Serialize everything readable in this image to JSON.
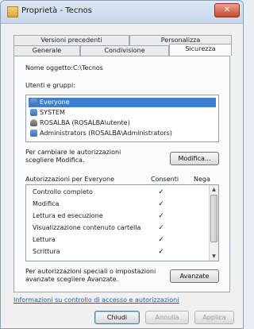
{
  "window": {
    "title": "Proprietà - Tecnos",
    "close_label": "✕"
  },
  "tabs": {
    "row1": [
      {
        "label": "Versioni precedenti"
      },
      {
        "label": "Personalizza"
      }
    ],
    "row2": [
      {
        "label": "Generale"
      },
      {
        "label": "Condivisione"
      },
      {
        "label": "Sicurezza",
        "active": true
      }
    ]
  },
  "object": {
    "label": "Nome oggetto:",
    "value": "C:\\Tecnos"
  },
  "groups": {
    "label": "Utenti e gruppi:",
    "items": [
      {
        "label": "Everyone",
        "icon": "group-icon",
        "selected": true
      },
      {
        "label": "SYSTEM",
        "icon": "group-icon"
      },
      {
        "label": "ROSALBA (ROSALBA\\utente)",
        "icon": "user-icon"
      },
      {
        "label": "Administrators (ROSALBA\\Administrators)",
        "icon": "group-icon"
      }
    ]
  },
  "modify": {
    "hint_line1": "Per cambiare le autorizzazioni",
    "hint_line2": "scegliere Modifica.",
    "button": "Modifica..."
  },
  "permissions": {
    "header": "Autorizzazioni per Everyone",
    "allow_header": "Consenti",
    "deny_header": "Nega",
    "rows": [
      {
        "name": "Controllo completo",
        "allow": "✓",
        "deny": ""
      },
      {
        "name": "Modifica",
        "allow": "✓",
        "deny": ""
      },
      {
        "name": "Lettura ed esecuzione",
        "allow": "✓",
        "deny": ""
      },
      {
        "name": "Visualizzazione contenuto cartella",
        "allow": "✓",
        "deny": ""
      },
      {
        "name": "Lettura",
        "allow": "✓",
        "deny": ""
      },
      {
        "name": "Scrittura",
        "allow": "✓",
        "deny": ""
      }
    ]
  },
  "advanced": {
    "hint_line1": "Per autorizzazioni speciali o impostazioni",
    "hint_line2": "avanzate scegliere Avanzate.",
    "button": "Avanzate"
  },
  "link": "Informazioni su controllo di accesso e autorizzazioni",
  "footer": {
    "ok": "Chiudi",
    "cancel": "Annulla",
    "apply": "Applica"
  }
}
